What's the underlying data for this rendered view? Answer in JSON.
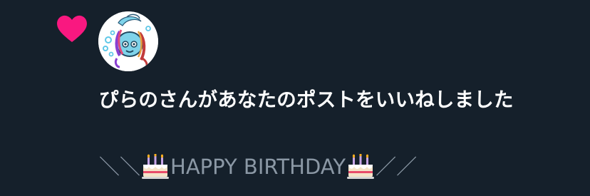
{
  "notification": {
    "type_icon": "heart-icon",
    "like_color": "#f91880",
    "avatar_icon": "avatar",
    "message": "ぴらのさんがあなたのポストをいいねしました",
    "preview": {
      "prefix": "＼＼",
      "cake_icon": "birthday-cake-icon",
      "text": "HAPPY BIRTHDAY",
      "suffix": "／／"
    }
  },
  "theme": {
    "background": "#15202b",
    "text_primary": "#ffffff",
    "text_secondary": "#8b98a5"
  }
}
